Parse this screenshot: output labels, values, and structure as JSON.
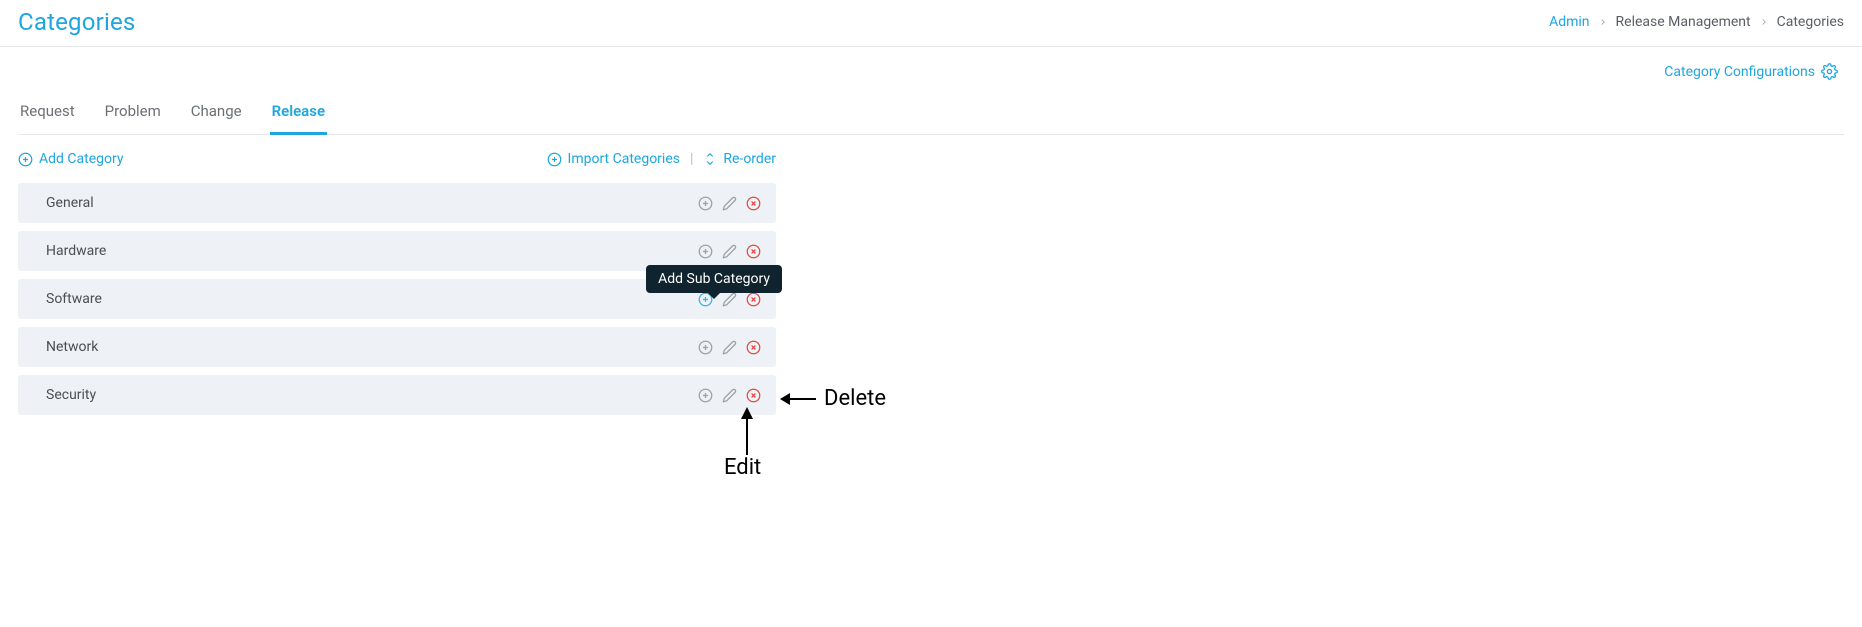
{
  "header": {
    "title": "Categories",
    "breadcrumbs": [
      {
        "label": "Admin",
        "link": true
      },
      {
        "label": "Release Management",
        "link": false
      },
      {
        "label": "Categories",
        "link": false
      }
    ]
  },
  "topLink": {
    "label": "Category Configurations"
  },
  "tabs": [
    {
      "label": "Request",
      "active": false
    },
    {
      "label": "Problem",
      "active": false
    },
    {
      "label": "Change",
      "active": false
    },
    {
      "label": "Release",
      "active": true
    }
  ],
  "actions": {
    "add": "Add Category",
    "import": "Import Categories",
    "reorder": "Re-order"
  },
  "categories": [
    {
      "name": "General",
      "highlightAdd": false
    },
    {
      "name": "Hardware",
      "highlightAdd": false
    },
    {
      "name": "Software",
      "highlightAdd": true
    },
    {
      "name": "Network",
      "highlightAdd": false
    },
    {
      "name": "Security",
      "highlightAdd": false
    }
  ],
  "tooltip": {
    "text": "Add Sub Category",
    "row": 2
  },
  "annotations": {
    "delete": "Delete",
    "edit": "Edit"
  }
}
